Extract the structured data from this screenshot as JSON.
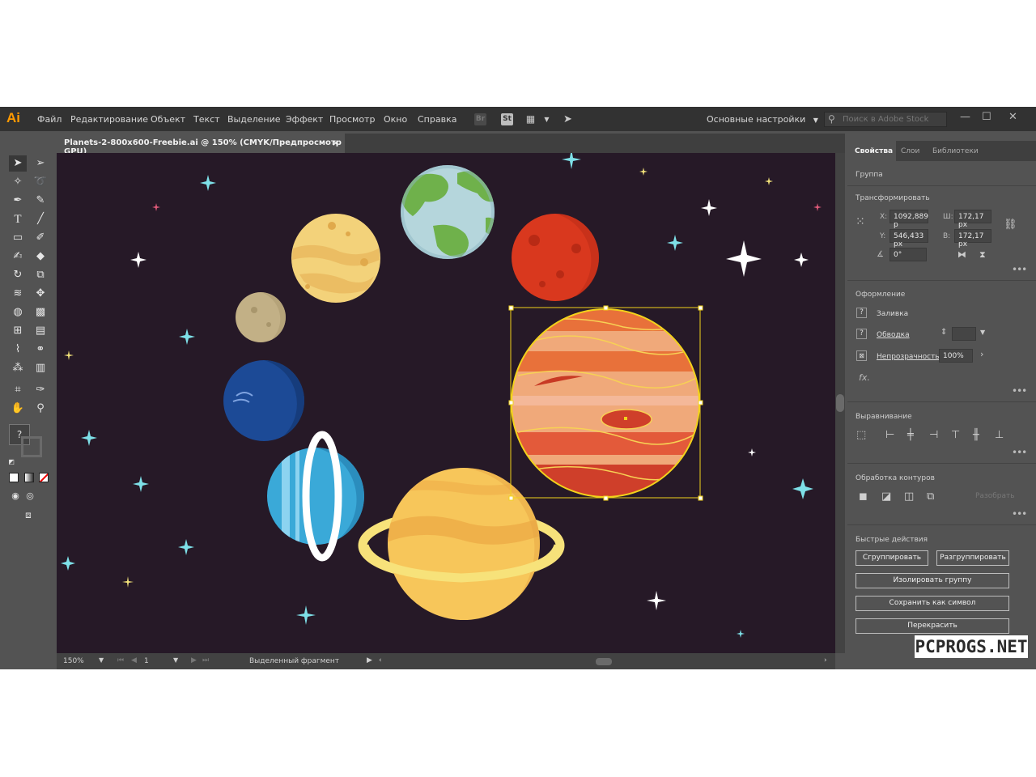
{
  "app": {
    "logo": "Ai"
  },
  "menu": [
    "Файл",
    "Редактирование",
    "Объект",
    "Текст",
    "Выделение",
    "Эффект",
    "Просмотр",
    "Окно",
    "Справка"
  ],
  "menubar_icons": {
    "br": "Br",
    "st": "St"
  },
  "workspace": {
    "label": "Основные настройки"
  },
  "stock_search": {
    "placeholder": "Поиск в Adobe Stock"
  },
  "window_controls": {
    "minimize": "—",
    "maximize": "☐",
    "close": "✕"
  },
  "document": {
    "tab_title": "Planets-2-800x600-Freebie.ai @ 150% (CMYK/Предпросмотр GPU)",
    "close": "×"
  },
  "status": {
    "zoom": "150%",
    "page": "1",
    "selection": "Выделенный фрагмент"
  },
  "panel": {
    "tabs": [
      "Свойства",
      "Слои",
      "Библиотеки"
    ],
    "object_type": "Группа",
    "transform": {
      "title": "Трансформировать",
      "x_label": "X:",
      "x": "1092,889 p",
      "y_label": "Y:",
      "y": "546,433 px",
      "w_label": "Ш:",
      "w": "172,17 px",
      "h_label": "В:",
      "h": "172,17 px",
      "angle": "0°"
    },
    "appearance": {
      "title": "Оформление",
      "fill": "Заливка",
      "stroke": "Обводка",
      "opacity_label": "Непрозрачность",
      "opacity": "100%",
      "fx": "fx."
    },
    "align_title": "Выравнивание",
    "pathfinder": {
      "title": "Обработка контуров",
      "expand": "Разобрать"
    },
    "quick_actions": {
      "title": "Быстрые действия",
      "group": "Сгруппировать",
      "ungroup": "Разгруппировать",
      "isolate": "Изолировать группу",
      "save_symbol": "Сохранить как символ",
      "recolor": "Перекрасить"
    }
  },
  "watermark": "PCPROGS.NET",
  "colors": {
    "canvas_bg": "#261927",
    "ui_dark": "#323232",
    "ui_panel": "#535353",
    "selection": "#f2d21b",
    "accent_logo": "#ff9a00"
  }
}
